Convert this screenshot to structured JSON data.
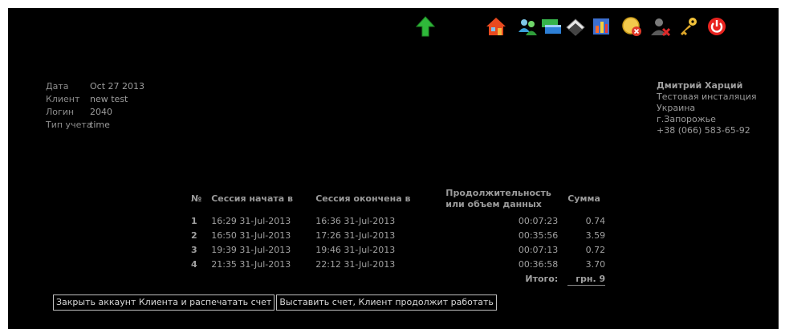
{
  "toolbar": {
    "icons": [
      "up-arrow-icon",
      "home-icon",
      "users-icon",
      "windows-icon",
      "book-icon",
      "report-icon",
      "cancel-icon",
      "remove-user-icon",
      "key-icon",
      "power-icon"
    ]
  },
  "info": {
    "rows": [
      {
        "label": "Дата",
        "value": "Oct 27 2013"
      },
      {
        "label": "Клиент",
        "value": "new test"
      },
      {
        "label": "Логин",
        "value": "2040"
      },
      {
        "label": "Тип учета",
        "value": "time"
      }
    ]
  },
  "company": {
    "name": "Дмитрий Харций",
    "line1": "Тестовая инсталяция",
    "line2": "Укрaина",
    "line3": "г.Запорожье",
    "phone": "+38 (066) 583-65-92"
  },
  "table": {
    "headers": {
      "no": "№",
      "start": "Сессия начата в",
      "end": "Сессия окончена в",
      "duration_line1": "Продолжительность",
      "duration_line2": "или объем данных",
      "sum": "Сумма"
    },
    "rows": [
      {
        "no": "1",
        "start": "16:29 31-Jul-2013",
        "end": "16:36 31-Jul-2013",
        "duration": "00:07:23",
        "sum": "0.74"
      },
      {
        "no": "2",
        "start": "16:50 31-Jul-2013",
        "end": "17:26 31-Jul-2013",
        "duration": "00:35:56",
        "sum": "3.59"
      },
      {
        "no": "3",
        "start": "19:39 31-Jul-2013",
        "end": "19:46 31-Jul-2013",
        "duration": "00:07:13",
        "sum": "0.72"
      },
      {
        "no": "4",
        "start": "21:35 31-Jul-2013",
        "end": "22:12 31-Jul-2013",
        "duration": "00:36:58",
        "sum": "3.70"
      }
    ],
    "total_label": "Итого:",
    "total_value": "грн. 9"
  },
  "actions": {
    "close_label": "Закрыть аккаунт Клиента и распечатать счет",
    "invoice_label": "Выставить счет, Клиент продолжит работать"
  }
}
